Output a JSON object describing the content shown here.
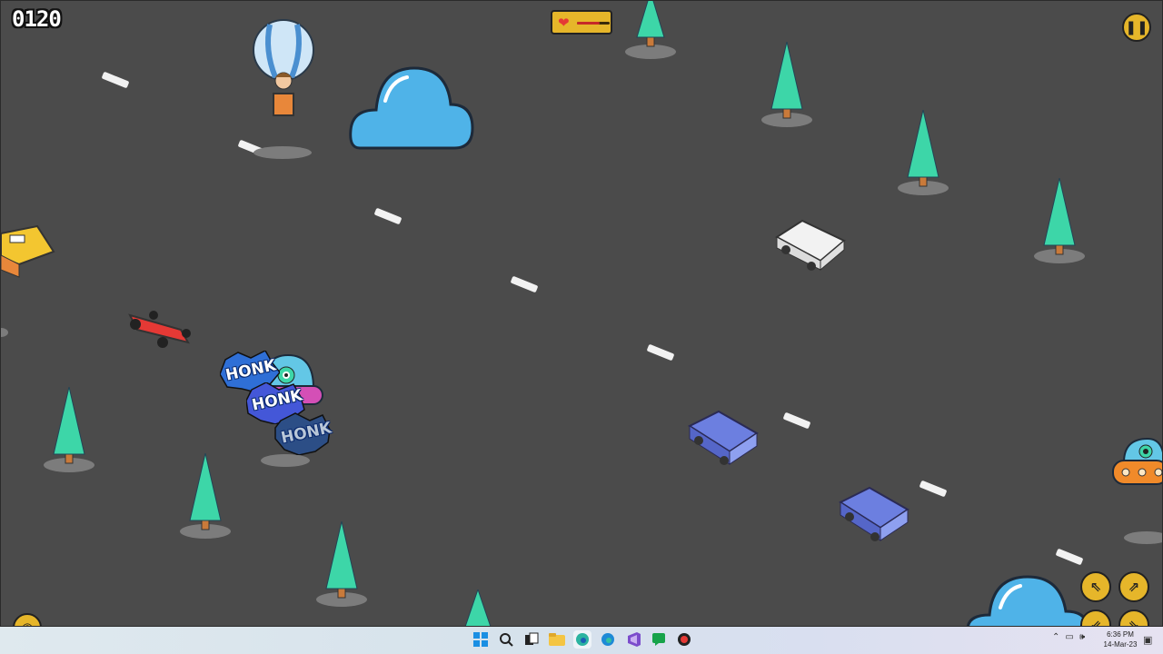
{
  "hud": {
    "score": "0120",
    "health": 0.7,
    "pause_icon": "pause-icon",
    "bottom_left_icon": "target-icon"
  },
  "speech": {
    "honk1": "HONK",
    "honk2": "HONK",
    "honk3": "HONK"
  },
  "controls": {
    "up_left": "⇖",
    "up_right": "⇗",
    "down_left": "⇙",
    "down_right": "⇘"
  },
  "taskbar": {
    "time": "6:36 PM",
    "date": "14-Mar-23",
    "icons": [
      "windows-start-icon",
      "search-icon",
      "task-view-icon",
      "file-explorer-icon",
      "edge-beta-icon",
      "edge-icon",
      "visual-studio-icon",
      "chat-icon",
      "recorder-icon"
    ]
  },
  "colors": {
    "road": "#4b4b4b",
    "hud_yellow": "#e6b62a",
    "tree": "#3dd6a8",
    "cloud": "#4fb3e8"
  }
}
